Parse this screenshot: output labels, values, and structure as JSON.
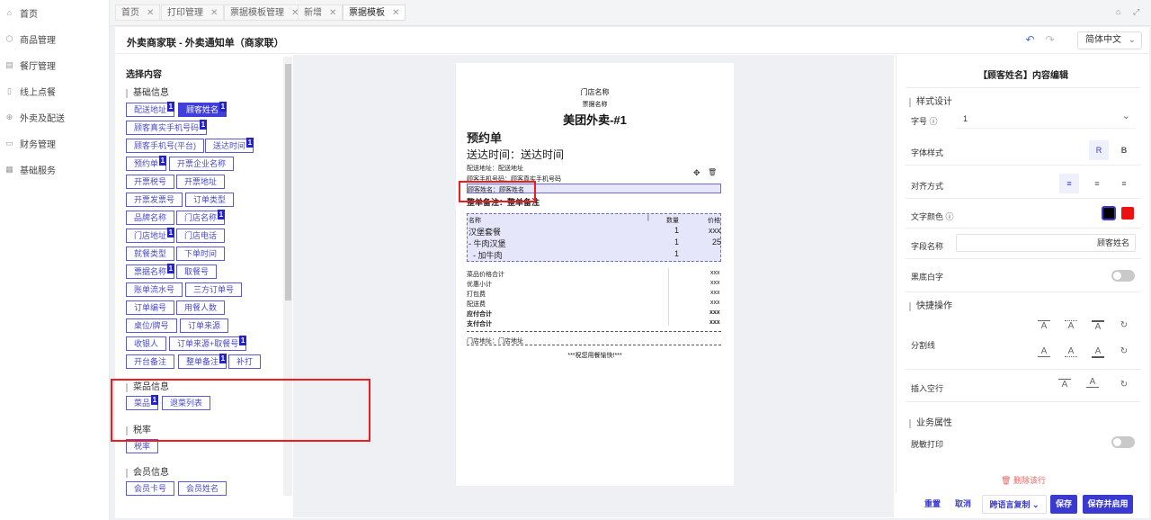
{
  "sidebar": {
    "items": [
      {
        "label": "首页",
        "icon": "home-icon",
        "glyph": "⌂"
      },
      {
        "label": "商品管理",
        "icon": "cube-icon",
        "glyph": "⬡"
      },
      {
        "label": "餐厅管理",
        "icon": "store-icon",
        "glyph": "▤"
      },
      {
        "label": "线上点餐",
        "icon": "phone-icon",
        "glyph": "▯"
      },
      {
        "label": "外卖及配送",
        "icon": "delivery-icon",
        "glyph": "⊕"
      },
      {
        "label": "财务管理",
        "icon": "wallet-icon",
        "glyph": "▭"
      },
      {
        "label": "基础服务",
        "icon": "grid-icon",
        "glyph": "▦"
      }
    ]
  },
  "tabs": [
    {
      "label": "首页"
    },
    {
      "label": "打印管理"
    },
    {
      "label": "票据模板管理"
    },
    {
      "label": "新增"
    },
    {
      "label": "票据模板"
    }
  ],
  "tab_close": "✕",
  "header": {
    "title": "外卖商家联 - 外卖通知单（商家联）",
    "language": "简体中文",
    "undo": "↶",
    "redo": "↷"
  },
  "left": {
    "title": "选择内容",
    "sections": {
      "basic": "基础信息",
      "dish": "菜品信息",
      "tax": "税率",
      "member": "会员信息"
    },
    "fields": {
      "f1": "配送地址",
      "f2": "顾客姓名",
      "f3": "顾客真实手机号码",
      "f4": "顾客手机号(平台)",
      "f5": "送达时间",
      "f6": "预约单",
      "f7": "开票企业名称",
      "f8": "开票税号",
      "f9": "开票地址",
      "f10": "开票发票号",
      "f11": "订单类型",
      "f12": "品牌名称",
      "f13": "门店名称",
      "f14": "门店地址",
      "f15": "门店电话",
      "f16": "就餐类型",
      "f17": "下单时间",
      "f18": "票据名称",
      "f19": "取餐号",
      "f20": "账单流水号",
      "f21": "三方订单号",
      "f22": "订单编号",
      "f23": "用餐人数",
      "f24": "桌位/牌号",
      "f25": "订单来源",
      "f26": "收银人",
      "f27": "订单来源+取餐号",
      "f28": "开台备注",
      "f29": "整单备注",
      "f30": "补打",
      "f31": "菜品",
      "f32": "退菜列表",
      "f33": "税率",
      "f34": "会员卡号",
      "f35": "会员姓名"
    },
    "badge": "1"
  },
  "receipt": {
    "store": "门店名称",
    "bill_name": "票据名称",
    "main_title": "美团外卖-#1",
    "reserve": "预约单",
    "delivery_time": "送达时间：送达时间",
    "addr": "配送地址：配送地址",
    "phone": "顾客手机号码：顾客真实手机号码",
    "customer": "顾客姓名：顾客姓名",
    "remark": "整单备注：整单备注",
    "table": {
      "h_name": "名称",
      "h_qty": "数量",
      "h_price": "价格",
      "rows": [
        {
          "name": "汉堡套餐",
          "qty": "1",
          "price": "xxx"
        },
        {
          "name": "- 牛肉汉堡",
          "qty": "1",
          "price": "25"
        },
        {
          "name": "  - 加牛肉",
          "qty": "1",
          "price": ""
        }
      ]
    },
    "totals": [
      {
        "label": "菜品价格合计",
        "value": "xxx"
      },
      {
        "label": "优惠小计",
        "value": "xxx"
      },
      {
        "label": "打包费",
        "value": "xxx"
      },
      {
        "label": "配送费",
        "value": "xxx"
      },
      {
        "label": "应付合计",
        "value": "xxx"
      },
      {
        "label": "支付合计",
        "value": "xxx"
      }
    ],
    "store_addr": "门店地址：门店地址",
    "footer": "***祝您用餐愉快!***",
    "move_icon": "✥",
    "delete_icon": "🗑"
  },
  "right": {
    "title": "【顾客姓名】内容编辑",
    "style_section": "样式设计",
    "font_size_label": "字号",
    "font_size_value": "1",
    "font_style_label": "字体样式",
    "regular": "R",
    "bold": "B",
    "align_label": "对齐方式",
    "color_label": "文字颜色",
    "field_name_label": "字段名称",
    "field_name_value": "顾客姓名",
    "black_bg_label": "黑底白字",
    "quick_section": "快捷操作",
    "divider_label": "分割线",
    "insert_line_label": "插入空行",
    "biz_section": "业务属性",
    "mask_label": "脱敏打印",
    "delete_row": "删除该行",
    "glyph_a": "A",
    "reset": "↻",
    "info": "ⓘ",
    "chev": "⌄",
    "colors": {
      "black": "#000000",
      "red": "#ee1111"
    }
  },
  "footer_buttons": {
    "reset": "重置",
    "cancel": "取消",
    "copy": "跨语言复制",
    "save": "保存",
    "save_enable": "保存并启用"
  },
  "colors": {
    "accent": "#3a3ad0",
    "highlight": "#f01c1c"
  }
}
